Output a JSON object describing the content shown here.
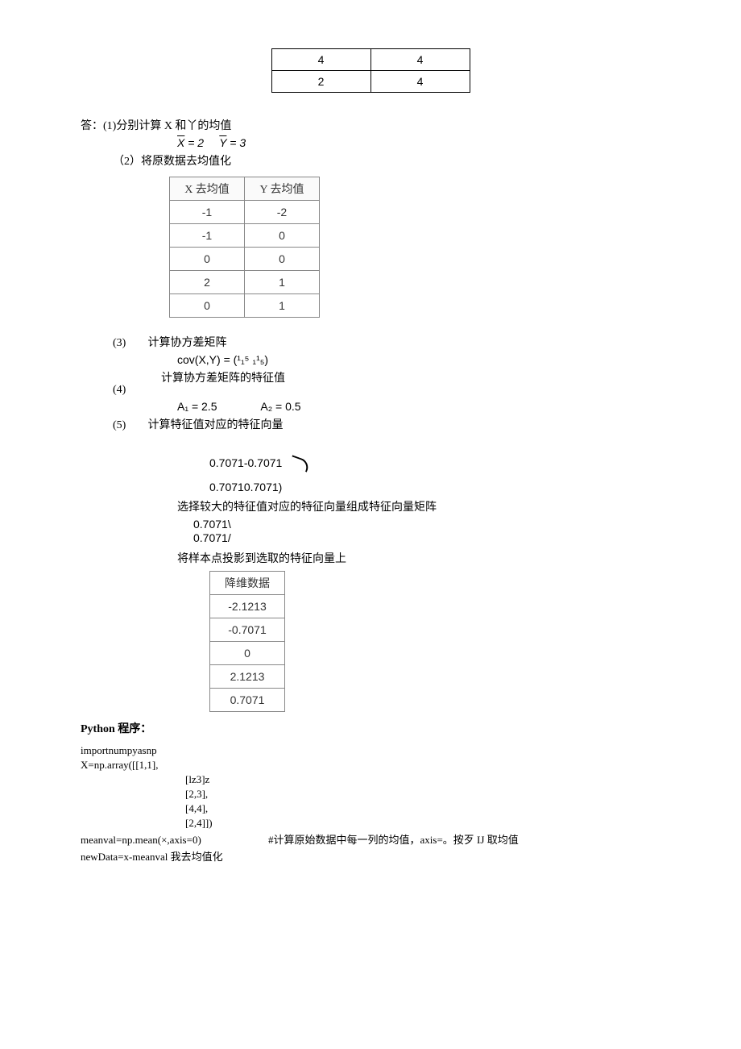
{
  "top_table": {
    "rows": [
      {
        "c1": "4",
        "c2": "4"
      },
      {
        "c1": "2",
        "c2": "4"
      }
    ]
  },
  "answer_intro": "答：(1)分别计算 X 和丫的均值",
  "mean_x_label": "X̄ = 2",
  "mean_y_label": "Ȳ = 3",
  "step2_label": "（2）将原数据去均值化",
  "demean_table": {
    "header_x": "X 去均值",
    "header_y": "Y 去均值",
    "rows": [
      {
        "x": "-1",
        "y": "-2"
      },
      {
        "x": "-1",
        "y": "0"
      },
      {
        "x": "0",
        "y": "0"
      },
      {
        "x": "2",
        "y": "1"
      },
      {
        "x": "0",
        "y": "1"
      }
    ]
  },
  "step3_num": "(3)",
  "step3_label": "计算协方差矩阵",
  "cov_formula": "cov(X,Y) = (¹₁⁵ ₁¹₅)",
  "step4_num": "(4)",
  "step4_label": "计算协方差矩阵的特征值",
  "eig_a1": "A₁ = 2.5",
  "eig_a2": "A₂ = 0.5",
  "step5_num": "(5)",
  "step5_label": "计算特征值对应的特征向量",
  "eigvec1": "0.7071-0.7071",
  "eigvec2": "0.70710.7071)",
  "select_text": "选择较大的特征值对应的特征向量组成特征向量矩阵",
  "vec_a": "0.7071\\",
  "vec_b": "0.7071/",
  "project_text": "将样本点投影到选取的特征向量上",
  "reduced_table": {
    "header": "降维数据",
    "rows": [
      "-2.1213",
      "-0.7071",
      "0",
      "2.1213",
      "0.7071"
    ]
  },
  "python_label": "Python 程序：",
  "code": {
    "l1": "importnumpyasnp",
    "l2": "X=np.array([[1,1],",
    "l3": "[lz3]z",
    "l4": "[2,3],",
    "l5": "[4,4],",
    "l6": "[2,4]])",
    "l7": "meanval=np.mean(×,axis=0)",
    "l7c": "#计算原始数据中每一列的均值，axis=。按歹 IJ 取均值",
    "l8": "newData=x-meanval 我去均值化"
  }
}
